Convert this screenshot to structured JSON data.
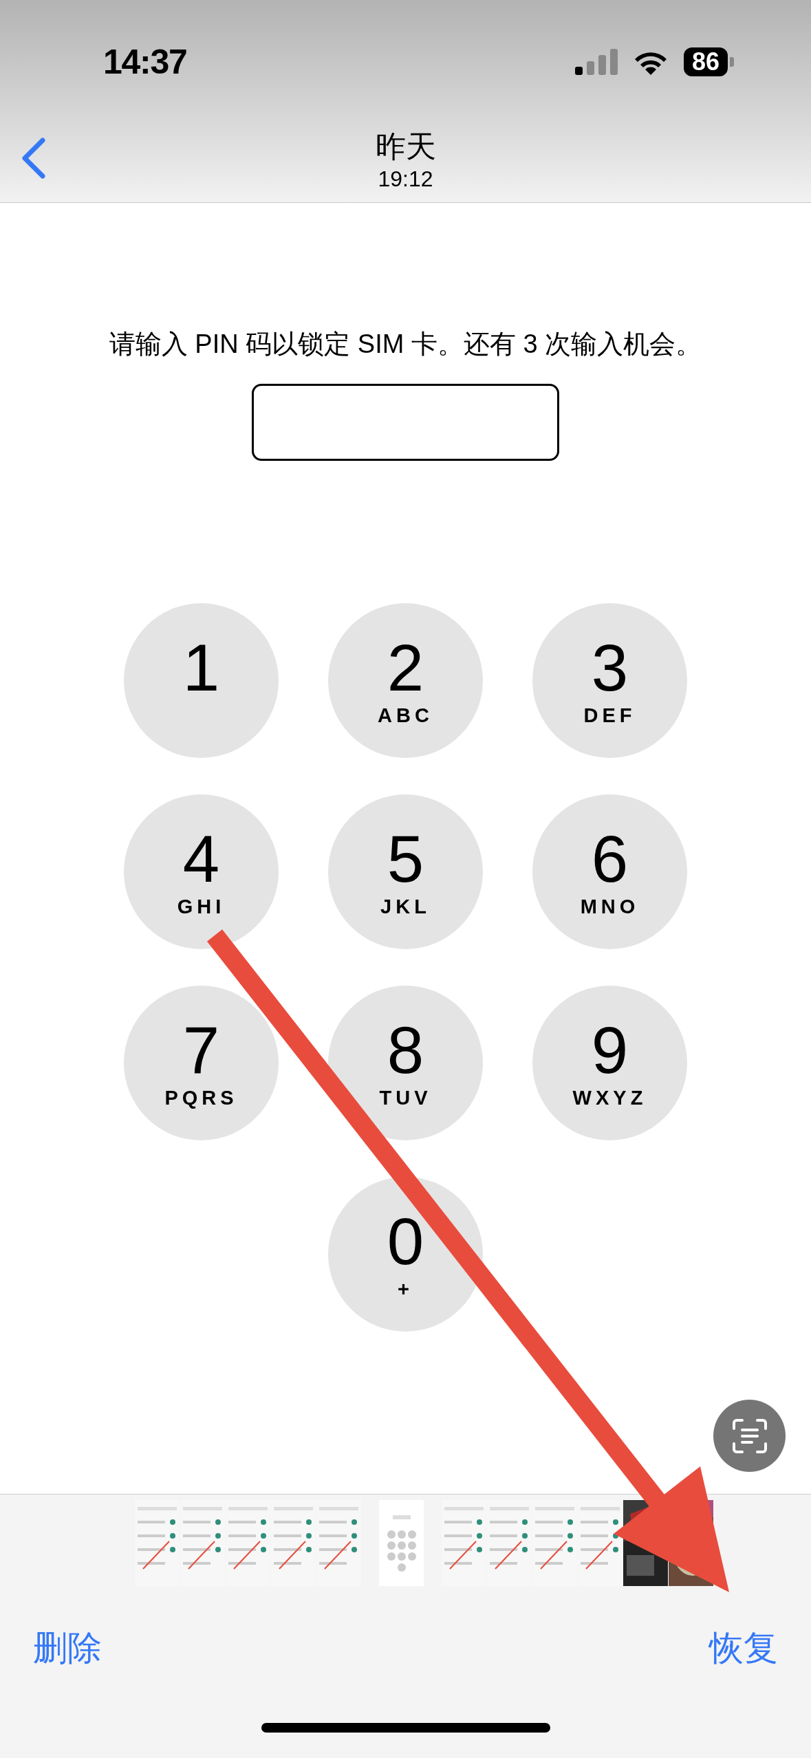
{
  "status_bar": {
    "time": "14:37",
    "battery": "86"
  },
  "nav_bar": {
    "title": "昨天",
    "subtitle": "19:12"
  },
  "screenshot": {
    "prompt": "请输入 PIN 码以锁定 SIM 卡。还有 3 次输入机会。",
    "keypad": [
      {
        "digit": "1"
      },
      {
        "digit": "2",
        "letters": "ABC"
      },
      {
        "digit": "3",
        "letters": "DEF"
      },
      {
        "digit": "4",
        "letters": "GHI"
      },
      {
        "digit": "5",
        "letters": "JKL"
      },
      {
        "digit": "6",
        "letters": "MNO"
      },
      {
        "digit": "7",
        "letters": "PQRS"
      },
      {
        "digit": "8",
        "letters": "TUV"
      },
      {
        "digit": "9",
        "letters": "WXYZ"
      },
      {
        "digit": "0",
        "letters": "+"
      }
    ]
  },
  "toolbar": {
    "delete": "删除",
    "recover": "恢复"
  }
}
